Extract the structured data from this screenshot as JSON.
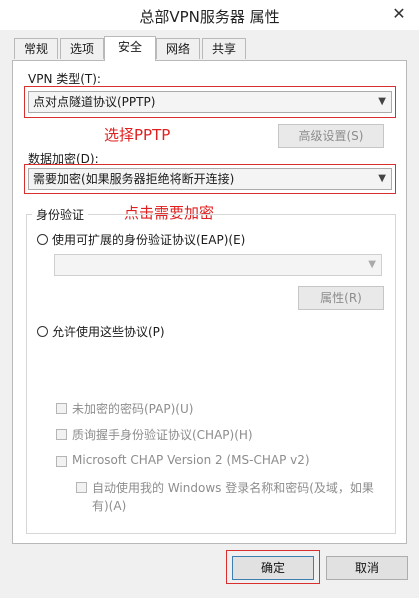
{
  "window": {
    "title": "总部VPN服务器 属性",
    "close_glyph": "✕"
  },
  "tabs": [
    {
      "label": "常规",
      "active": false
    },
    {
      "label": "选项",
      "active": false
    },
    {
      "label": "安全",
      "active": true
    },
    {
      "label": "网络",
      "active": false
    },
    {
      "label": "共享",
      "active": false
    }
  ],
  "security": {
    "vpn_type_label": "VPN 类型(T):",
    "vpn_type_value": "点对点隧道协议(PPTP)",
    "advanced_button": "高级设置(S)",
    "encryption_label": "数据加密(D):",
    "encryption_value": "需要加密(如果服务器拒绝将断开连接)",
    "auth_group_label": "身份验证",
    "eap_radio_label": "使用可扩展的身份验证协议(EAP)(E)",
    "eap_select_value": "",
    "properties_button": "属性(R)",
    "allow_protocols_label": "允许使用这些协议(P)",
    "checkboxes": {
      "pap": "未加密的密码(PAP)(U)",
      "chap": "质询握手身份验证协议(CHAP)(H)",
      "mschap": "Microsoft CHAP Version 2 (MS-CHAP v2)",
      "auto_windows_line1": "自动使用我的 Windows 登录名称和密码(及域，如果",
      "auto_windows_line2": "有)(A)"
    }
  },
  "annotations": {
    "select_pptp": "选择PPTP",
    "click_require_encryption": "点击需要加密"
  },
  "footer": {
    "ok_button": "确定",
    "cancel_button": "取消"
  },
  "colors": {
    "annotation_red": "#d9302f",
    "window_bg": "#f0f0f0"
  }
}
